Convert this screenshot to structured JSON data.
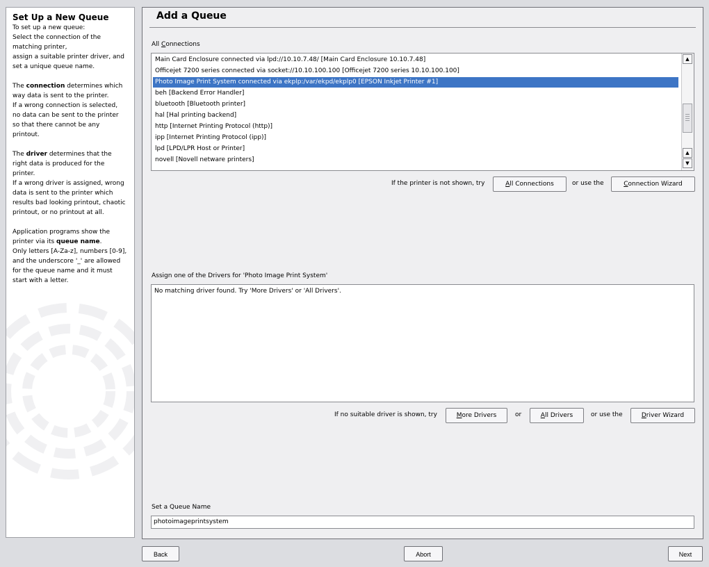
{
  "help": {
    "title": "Set Up a New Queue",
    "intro": [
      "To set up a new queue:",
      "Select the connection of the",
      "matching printer,",
      "assign a suitable printer driver, and",
      "set a unique queue name."
    ],
    "conn_lines": [
      "The ",
      "connection",
      " determines which",
      "way data is sent to the printer.",
      "If a wrong connection is selected,",
      "no data can be sent to the printer",
      "so that there cannot be any",
      "printout."
    ],
    "driver_lines": [
      "The ",
      "driver",
      " determines that the",
      "right data is produced for the",
      "printer.",
      "If a wrong driver is assigned, wrong",
      "data is sent to the printer which",
      "results bad looking printout, chaotic",
      "printout, or no printout at all."
    ],
    "queue_lines": [
      "Application programs show the",
      "printer via its ",
      "queue name",
      ".",
      "Only letters [A-Za-z], numbers [0-9],",
      "and the underscore '_' are allowed",
      "for the queue name and it must",
      "start with a letter."
    ]
  },
  "main": {
    "title": "Add a Queue",
    "connections_label_pre": "All ",
    "connections_label_u": "C",
    "connections_label_post": "onnections",
    "connections": [
      {
        "text": "Main Card Enclosure connected via lpd://10.10.7.48/ [Main Card Enclosure 10.10.7.48]",
        "selected": false
      },
      {
        "text": "Officejet 7200 series connected via socket://10.10.100.100 [Officejet 7200 series 10.10.100.100]",
        "selected": false
      },
      {
        "text": "Photo Image Print System connected via ekplp:/var/ekpd/ekplp0 [EPSON Inkjet Printer #1]",
        "selected": true
      },
      {
        "text": "beh [Backend Error Handler]",
        "selected": false
      },
      {
        "text": "bluetooth [Bluetooth printer]",
        "selected": false
      },
      {
        "text": "hal [Hal printing backend]",
        "selected": false
      },
      {
        "text": "http [Internet Printing Protocol (http)]",
        "selected": false
      },
      {
        "text": "ipp [Internet Printing Protocol (ipp)]",
        "selected": false
      },
      {
        "text": "lpd [LPD/LPR Host or Printer]",
        "selected": false
      },
      {
        "text": "novell [Novell netware printers]",
        "selected": false
      }
    ],
    "conn_hint": "If the printer is not shown, try",
    "all_connections_btn": "All Connections",
    "or_use_the_1": "or use the",
    "connection_wizard_btn": "Connection Wizard",
    "drivers_label": "Assign one of the Drivers for 'Photo Image Print System'",
    "driver_message": "No matching driver found. Try 'More Drivers' or 'All Drivers'.",
    "driver_hint": "If no suitable driver is shown, try",
    "more_drivers_btn": "More Drivers",
    "or": "or",
    "all_drivers_btn": "All Drivers",
    "or_use_the_2": "or use the",
    "driver_wizard_btn": "Driver Wizard",
    "queue_label": "Set a Queue Name",
    "queue_value": "photoimageprintsystem"
  },
  "nav": {
    "back": "Back",
    "abort": "Abort",
    "next": "Next"
  }
}
